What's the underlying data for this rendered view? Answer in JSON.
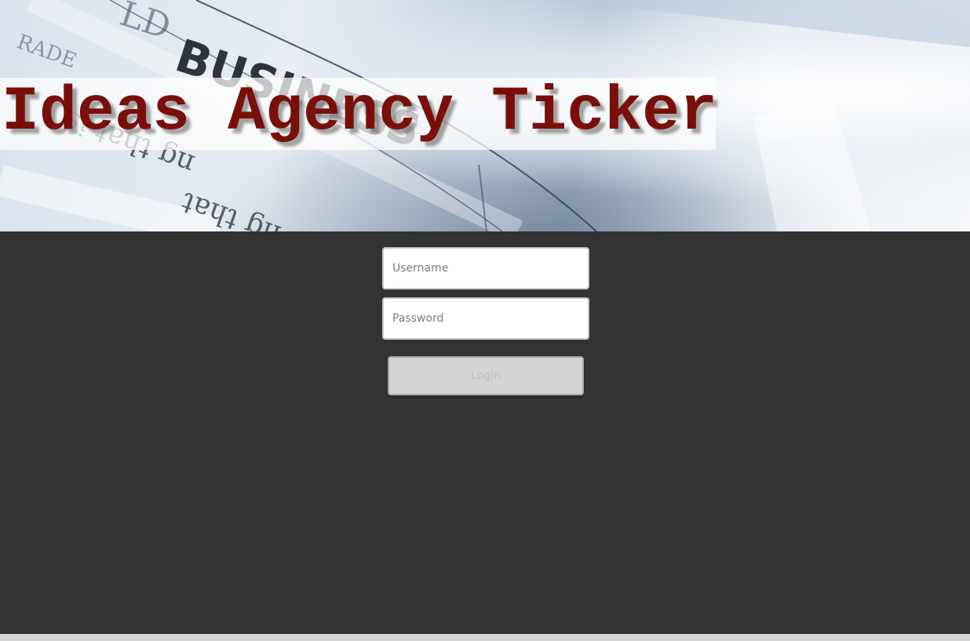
{
  "header": {
    "title": "Ideas Agency Ticker",
    "title_color": "#7a0f0a",
    "background_image": "newspaper-business-photo"
  },
  "login": {
    "username_placeholder": "Username",
    "username_value": "",
    "password_placeholder": "Password",
    "password_value": "",
    "submit_label": "Login"
  },
  "colors": {
    "page_background": "#333333",
    "button_background": "#d3d3d3",
    "footer_bar": "#d5d5d5"
  }
}
